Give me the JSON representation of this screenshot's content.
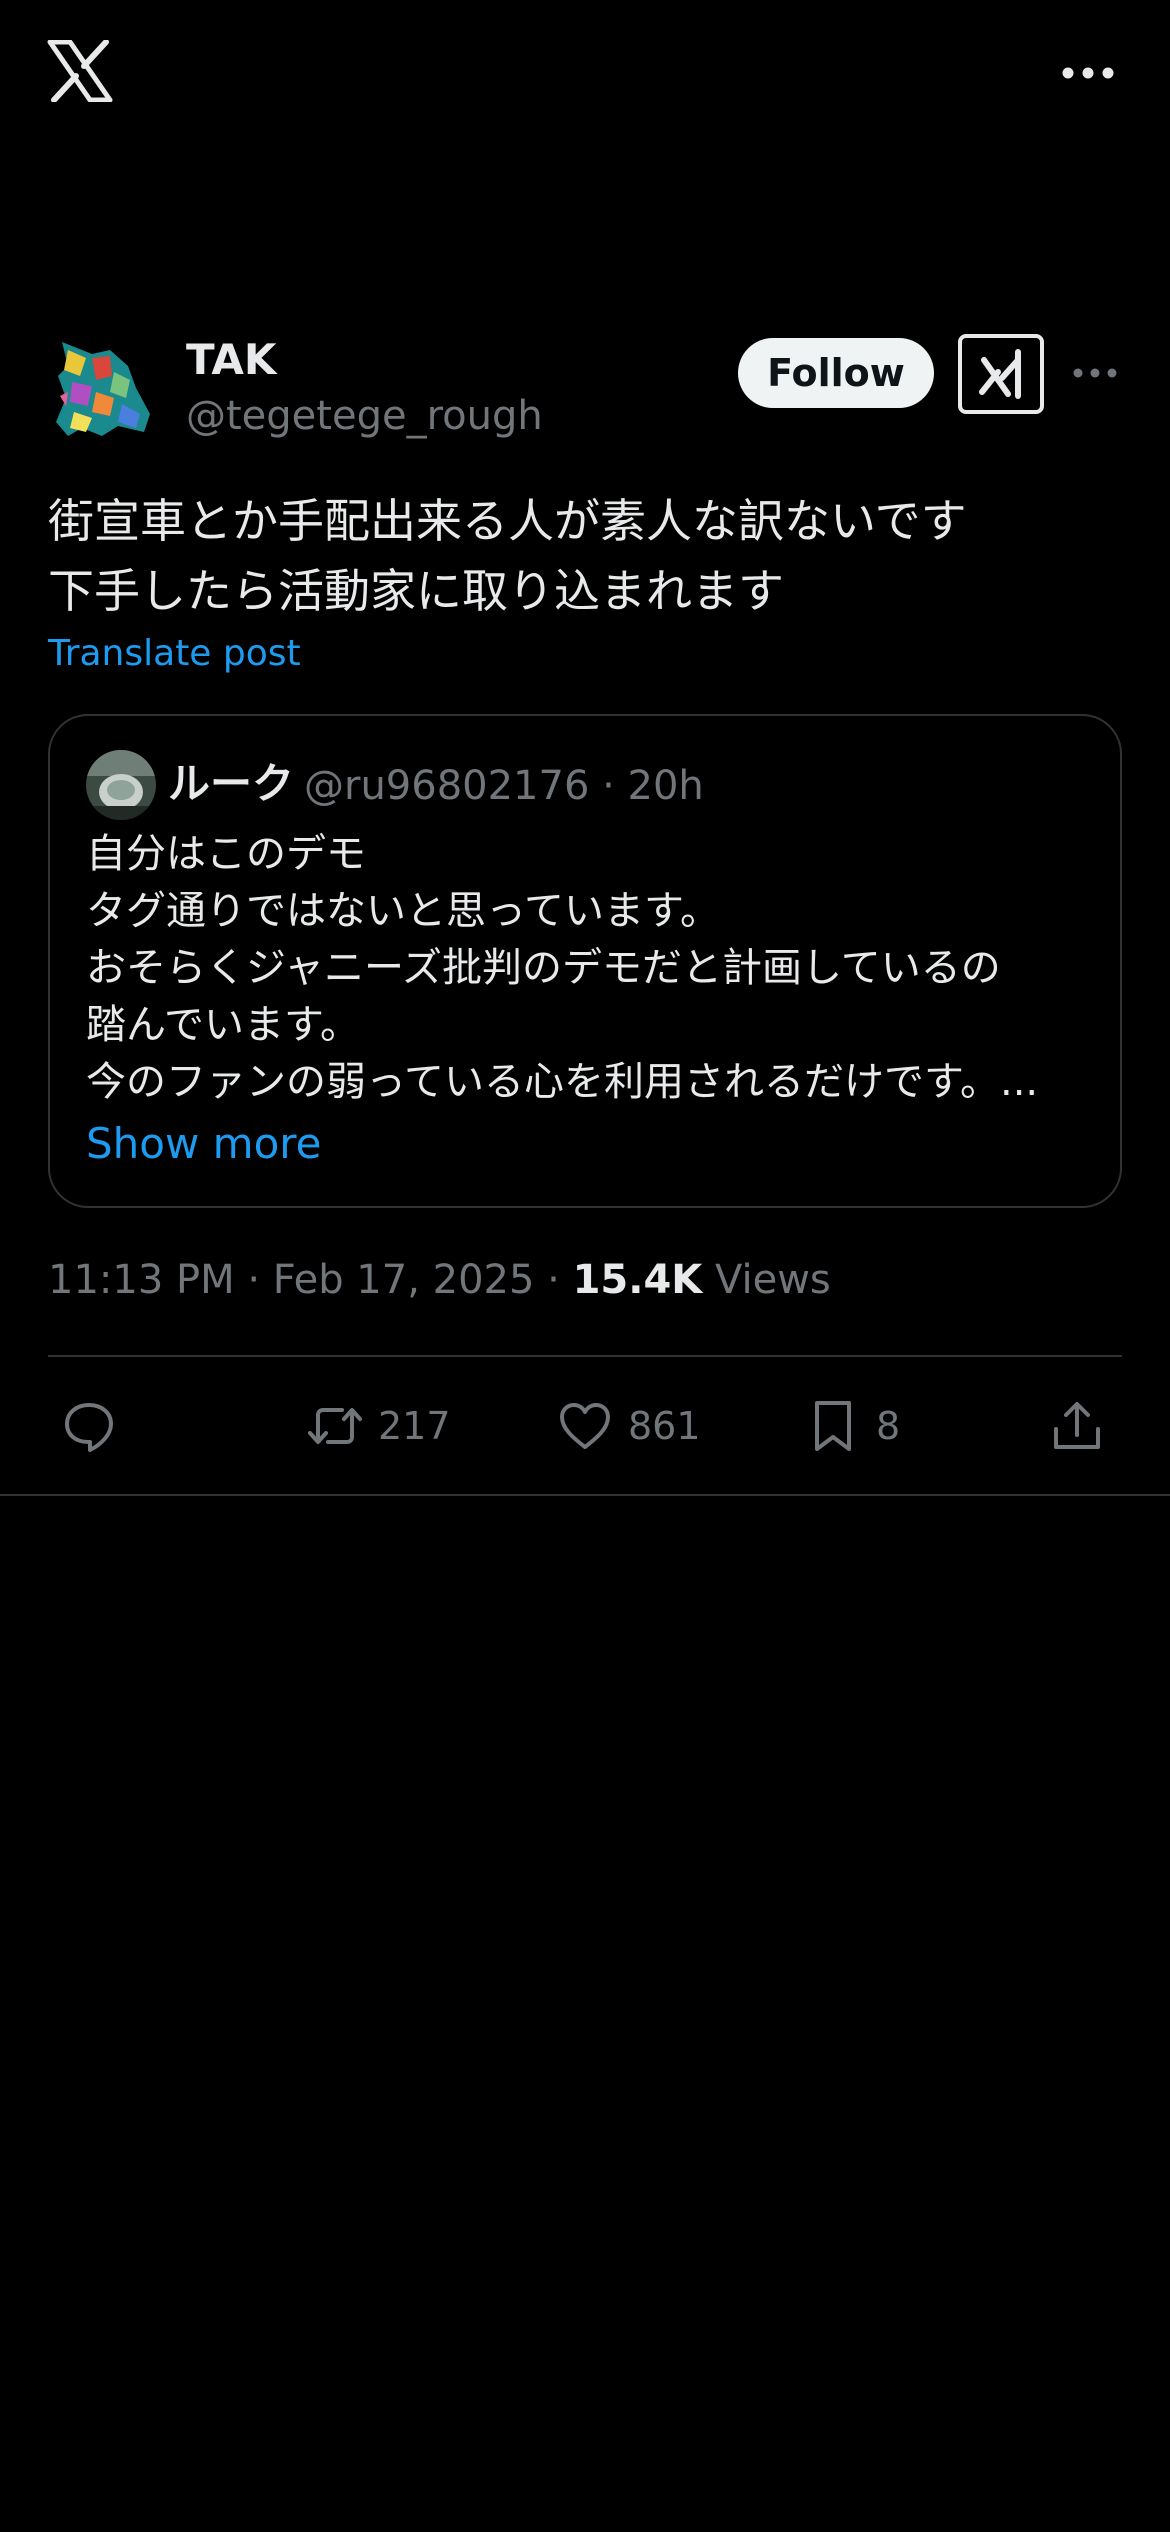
{
  "app": {
    "logo_icon": "x-logo-icon",
    "more_icon": "more-horizontal-icon"
  },
  "post": {
    "author": {
      "display_name": "TAK",
      "handle": "@tegetege_rough",
      "avatar_icon": "colorful-bird-avatar"
    },
    "follow_label": "Follow",
    "grok_icon": "grok-icon",
    "text": "街宣車とか手配出来る人が素人な訳ないです\n下手したら活動家に取り込まれます",
    "translate_label": "Translate post",
    "timestamp": "11:13 PM · Feb 17, 2025 · ",
    "views_count": "15.4K",
    "views_label": " Views"
  },
  "quote": {
    "author_name": "ルーク",
    "meta": "@ru96802176 · 20h",
    "text": "自分はこのデモ\nタグ通りではないと思っています。\nおそらくジャニーズ批判のデモだと計画しているの\n踏んでいます。\n今のファンの弱っている心を利用されるだけです。...",
    "show_more_label": "Show more"
  },
  "actions": {
    "reply_count": "",
    "retweet_count": "217",
    "like_count": "861",
    "bookmark_count": "8"
  },
  "colors": {
    "background": "#000000",
    "text_primary": "#e7e9ea",
    "text_secondary": "#71767b",
    "accent": "#1d9bf0",
    "border": "#2f3336",
    "follow_bg": "#eff3f4"
  }
}
